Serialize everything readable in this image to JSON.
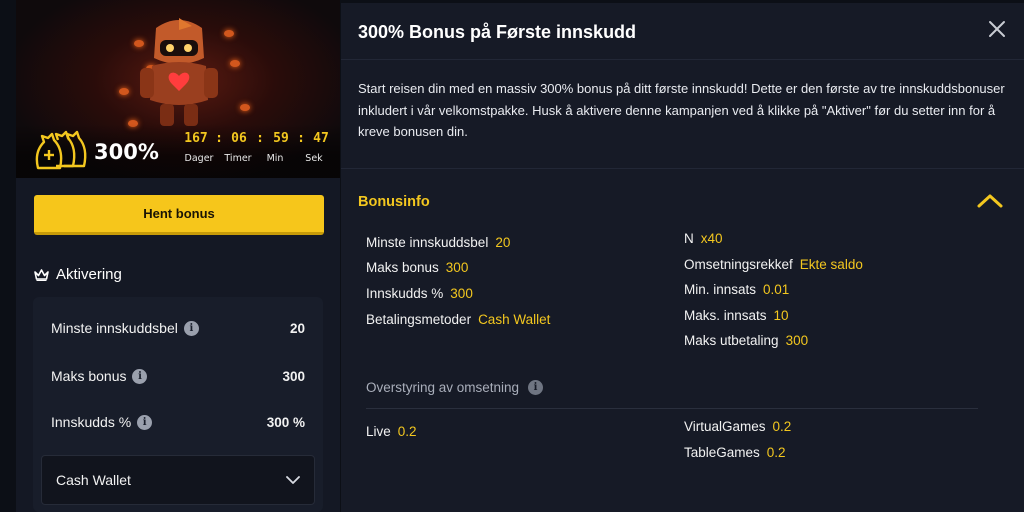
{
  "promo": {
    "bonus_percent": "300%",
    "timer": {
      "days": "167",
      "hours": "06",
      "minutes": "59",
      "seconds": "47",
      "sep": ":",
      "labels": {
        "days": "Dager",
        "hours": "Timer",
        "minutes": "Min",
        "seconds": "Sek"
      }
    },
    "cta_label": "Hent bonus"
  },
  "activation": {
    "title": "Aktivering",
    "rows": [
      {
        "label": "Minste innskuddsbel",
        "value": "20"
      },
      {
        "label": "Maks bonus",
        "value": "300"
      },
      {
        "label": "Innskudds %",
        "value": "300 %"
      }
    ],
    "wallet_select": "Cash Wallet"
  },
  "detail": {
    "title": "300% Bonus på Første innskudd",
    "description": "Start reisen din med en massiv 300% bonus på ditt første innskudd! Dette er den første av tre innskuddsbonuser inkludert i vår velkomstpakke. Husk å aktivere denne kampanjen ved å klikke på \"Aktiver\" før du setter inn for å kreve bonusen din.",
    "bonusinfo_title": "Bonusinfo",
    "left_rows": [
      {
        "label": "Minste innskuddsbel",
        "value": "20"
      },
      {
        "label": "Maks bonus",
        "value": "300"
      },
      {
        "label": "Innskudds %",
        "value": "300"
      },
      {
        "label": "Betalingsmetoder",
        "value": "Cash Wallet"
      }
    ],
    "right_rows": [
      {
        "label": "N",
        "value": "x40"
      },
      {
        "label": "Omsetningsrekkef",
        "value": "Ekte saldo"
      },
      {
        "label": "Min. innsats",
        "value": "0.01"
      },
      {
        "label": "Maks. innsats",
        "value": "10"
      },
      {
        "label": "Maks utbetaling",
        "value": "300"
      }
    ],
    "override_title": "Overstyring av omsetning",
    "override_left": [
      {
        "label": "Live",
        "value": "0.2"
      }
    ],
    "override_right": [
      {
        "label": "VirtualGames",
        "value": "0.2"
      },
      {
        "label": "TableGames",
        "value": "0.2"
      }
    ]
  },
  "icons": {
    "close": "close-icon",
    "chevron_up": "chevron-up-icon",
    "chevron_down": "chevron-down-icon",
    "crown": "crown-icon",
    "info": "info-icon",
    "money_bags": "money-bags-icon"
  },
  "colors": {
    "accent": "#f3c71f",
    "button": "#f6c61b",
    "panel": "#161a26",
    "background": "#0c0f16"
  }
}
